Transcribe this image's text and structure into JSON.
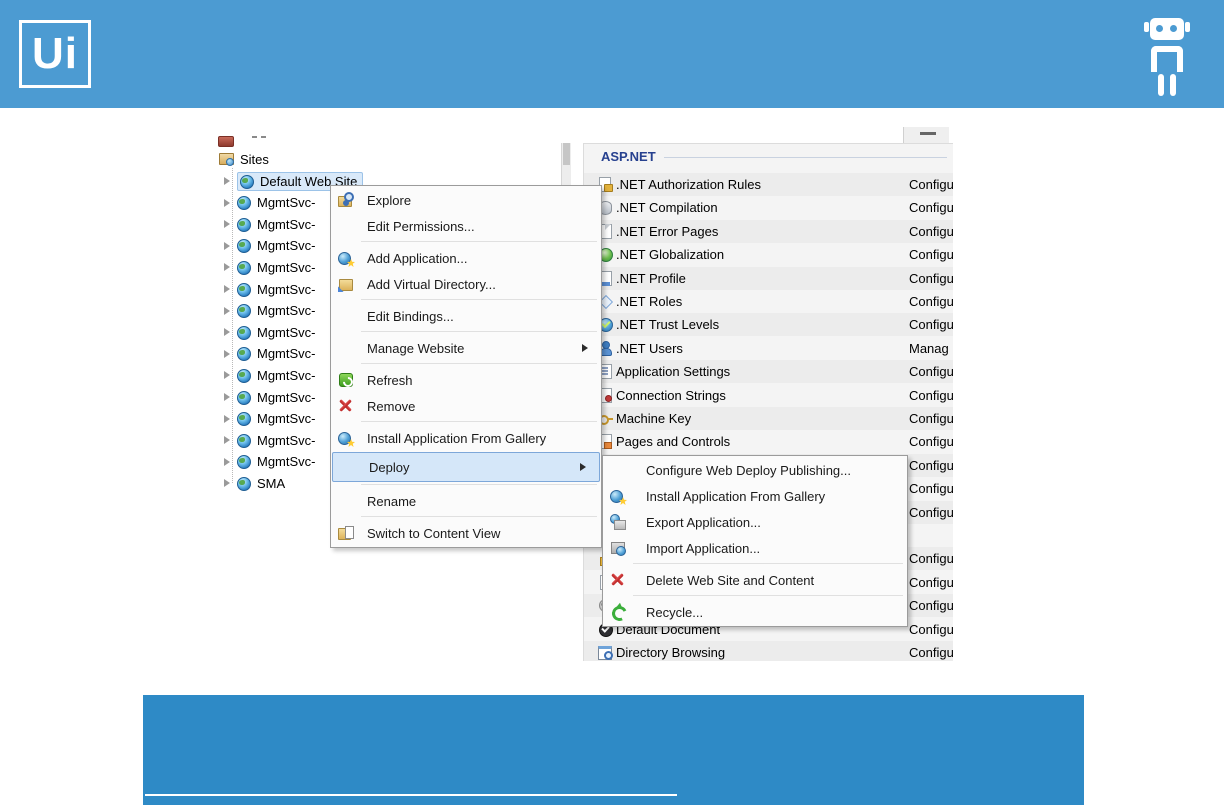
{
  "header": {
    "logo_text": "Ui"
  },
  "colors": {
    "header_blue": "#4C9BD2",
    "footer_blue": "#2E8AC6",
    "menu_highlight": "#D5E7F9",
    "selection_blue": "#D9E9F9"
  },
  "tree": {
    "items": [
      {
        "label": "Sites",
        "icon": "sites-folder-icon",
        "indent": 0,
        "twisty": false,
        "selected": false
      },
      {
        "label": "Default Web Site",
        "icon": "site-globe-icon",
        "indent": 1,
        "twisty": true,
        "selected": true
      },
      {
        "label": "MgmtSvc-",
        "icon": "site-globe-icon",
        "indent": 1,
        "twisty": true,
        "selected": false
      },
      {
        "label": "MgmtSvc-",
        "icon": "site-globe-icon",
        "indent": 1,
        "twisty": true,
        "selected": false
      },
      {
        "label": "MgmtSvc-",
        "icon": "site-globe-icon",
        "indent": 1,
        "twisty": true,
        "selected": false
      },
      {
        "label": "MgmtSvc-",
        "icon": "site-globe-icon",
        "indent": 1,
        "twisty": true,
        "selected": false
      },
      {
        "label": "MgmtSvc-",
        "icon": "site-globe-icon",
        "indent": 1,
        "twisty": true,
        "selected": false
      },
      {
        "label": "MgmtSvc-",
        "icon": "site-globe-icon",
        "indent": 1,
        "twisty": true,
        "selected": false
      },
      {
        "label": "MgmtSvc-",
        "icon": "site-globe-icon",
        "indent": 1,
        "twisty": true,
        "selected": false
      },
      {
        "label": "MgmtSvc-",
        "icon": "site-globe-icon",
        "indent": 1,
        "twisty": true,
        "selected": false
      },
      {
        "label": "MgmtSvc-",
        "icon": "site-globe-icon",
        "indent": 1,
        "twisty": true,
        "selected": false
      },
      {
        "label": "MgmtSvc-",
        "icon": "site-globe-icon",
        "indent": 1,
        "twisty": true,
        "selected": false
      },
      {
        "label": "MgmtSvc-",
        "icon": "site-globe-icon",
        "indent": 1,
        "twisty": true,
        "selected": false
      },
      {
        "label": "MgmtSvc-",
        "icon": "site-globe-icon",
        "indent": 1,
        "twisty": true,
        "selected": false
      },
      {
        "label": "MgmtSvc-",
        "icon": "site-globe-icon",
        "indent": 1,
        "twisty": true,
        "selected": false
      },
      {
        "label": "SMA",
        "icon": "site-globe-icon",
        "indent": 1,
        "twisty": true,
        "selected": false
      }
    ]
  },
  "context_menu": {
    "items": [
      {
        "type": "item",
        "label": "Explore",
        "icon": "explore-icon"
      },
      {
        "type": "item",
        "label": "Edit Permissions...",
        "icon": ""
      },
      {
        "type": "separator"
      },
      {
        "type": "item",
        "label": "Add Application...",
        "icon": "add-application-icon"
      },
      {
        "type": "item",
        "label": "Add Virtual Directory...",
        "icon": "add-virtual-directory-icon"
      },
      {
        "type": "separator"
      },
      {
        "type": "item",
        "label": "Edit Bindings...",
        "icon": ""
      },
      {
        "type": "separator"
      },
      {
        "type": "item",
        "label": "Manage Website",
        "icon": "",
        "submenu": true
      },
      {
        "type": "separator"
      },
      {
        "type": "item",
        "label": "Refresh",
        "icon": "refresh-icon"
      },
      {
        "type": "item",
        "label": "Remove",
        "icon": "remove-icon"
      },
      {
        "type": "separator"
      },
      {
        "type": "item",
        "label": "Install Application From Gallery",
        "icon": "gallery-icon"
      },
      {
        "type": "item",
        "label": "Deploy",
        "icon": "",
        "submenu": true,
        "highlighted": true
      },
      {
        "type": "separator"
      },
      {
        "type": "item",
        "label": "Rename",
        "icon": ""
      },
      {
        "type": "separator"
      },
      {
        "type": "item",
        "label": "Switch to Content View",
        "icon": "content-view-icon"
      }
    ]
  },
  "deploy_submenu": {
    "items": [
      {
        "type": "item",
        "label": "Configure Web Deploy Publishing...",
        "icon": ""
      },
      {
        "type": "item",
        "label": "Install Application From Gallery",
        "icon": "gallery-icon"
      },
      {
        "type": "item",
        "label": "Export Application...",
        "icon": "export-application-icon"
      },
      {
        "type": "item",
        "label": "Import Application...",
        "icon": "import-application-icon"
      },
      {
        "type": "separator"
      },
      {
        "type": "item",
        "label": "Delete Web Site and Content",
        "icon": "remove-icon"
      },
      {
        "type": "separator"
      },
      {
        "type": "item",
        "label": "Recycle...",
        "icon": "recycle-icon"
      }
    ]
  },
  "features_panel": {
    "section_title": "ASP.NET",
    "rows": [
      {
        "name": ".NET Authorization Rules",
        "value": "Configu",
        "icon": "authorization-rules-icon"
      },
      {
        "name": ".NET Compilation",
        "value": "Configu",
        "icon": "compilation-icon"
      },
      {
        "name": ".NET Error Pages",
        "value": "Configu",
        "icon": "error-pages-icon"
      },
      {
        "name": ".NET Globalization",
        "value": "Configu",
        "icon": "globalization-icon"
      },
      {
        "name": ".NET Profile",
        "value": "Configu",
        "icon": "profile-icon"
      },
      {
        "name": ".NET Roles",
        "value": "Configu",
        "icon": "roles-icon"
      },
      {
        "name": ".NET Trust Levels",
        "value": "Configu",
        "icon": "trust-levels-icon"
      },
      {
        "name": ".NET Users",
        "value": "Manag",
        "icon": "users-icon"
      },
      {
        "name": "Application Settings",
        "value": "Configu",
        "icon": "application-settings-icon"
      },
      {
        "name": "Connection Strings",
        "value": "Configu",
        "icon": "connection-strings-icon"
      },
      {
        "name": "Machine Key",
        "value": "Configu",
        "icon": "machine-key-icon"
      },
      {
        "name": "Pages and Controls",
        "value": "Configu",
        "icon": "pages-controls-icon"
      },
      {
        "name": "",
        "value": "Configu",
        "icon": ""
      },
      {
        "name": "",
        "value": "Configu",
        "icon": ""
      },
      {
        "name": "",
        "value": "Configu",
        "icon": ""
      },
      {
        "name": "",
        "value": "",
        "icon": ""
      },
      {
        "name": "",
        "value": "Configu",
        "icon": "authentication-icon"
      },
      {
        "name": "",
        "value": "Configu",
        "icon": "rules-list-icon"
      },
      {
        "name": "",
        "value": "Configu",
        "icon": "compression-icon"
      },
      {
        "name": "Default Document",
        "value": "Configu",
        "icon": "default-document-icon"
      },
      {
        "name": "Directory Browsing",
        "value": "Configu",
        "icon": "directory-browsing-icon"
      }
    ]
  }
}
